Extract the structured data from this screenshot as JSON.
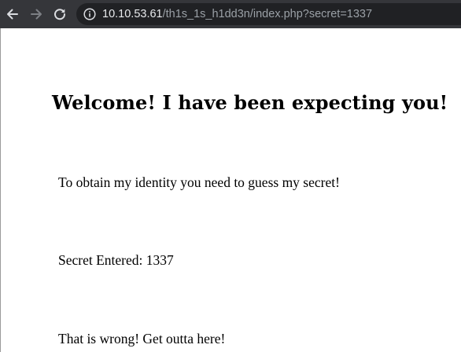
{
  "browser": {
    "url_host": "10.10.53.61",
    "url_path": "/th1s_1s_h1dd3n/index.php?secret=1337",
    "icons": {
      "back": "arrow-left-icon",
      "forward": "arrow-right-icon",
      "reload": "reload-icon",
      "site_info": "info-icon"
    },
    "colors": {
      "toolbar_bg": "#35363a",
      "omnibox_bg": "#202124",
      "url_host": "#e8eaed",
      "url_path": "#9aa0a6"
    }
  },
  "page": {
    "heading": "Welcome! I have been expecting you!",
    "instructions": "To obtain my identity you need to guess my secret!",
    "secret_entered": "Secret Entered: 1337",
    "result_message": "That is wrong! Get outta here!"
  }
}
